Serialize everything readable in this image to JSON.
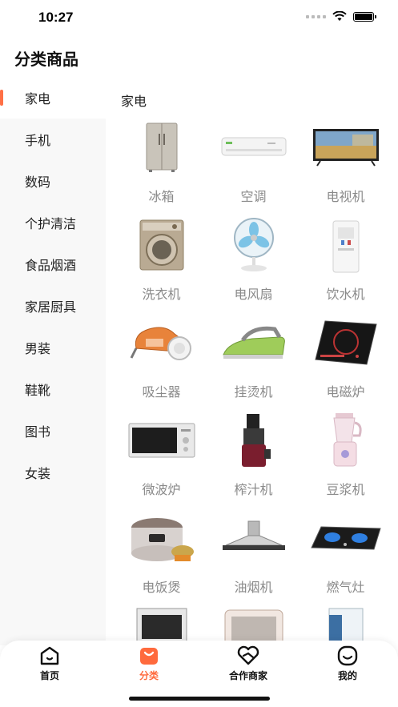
{
  "status": {
    "time": "10:27"
  },
  "page": {
    "title": "分类商品"
  },
  "sidebar": {
    "items": [
      {
        "label": "家电"
      },
      {
        "label": "手机"
      },
      {
        "label": "数码"
      },
      {
        "label": "个护清洁"
      },
      {
        "label": "食品烟酒"
      },
      {
        "label": "家居厨具"
      },
      {
        "label": "男装"
      },
      {
        "label": "鞋靴"
      },
      {
        "label": "图书"
      },
      {
        "label": "女装"
      }
    ]
  },
  "content": {
    "title": "家电",
    "products": [
      {
        "label": "冰箱",
        "icon": "fridge-icon"
      },
      {
        "label": "空调",
        "icon": "air-conditioner-icon"
      },
      {
        "label": "电视机",
        "icon": "tv-icon"
      },
      {
        "label": "洗衣机",
        "icon": "washing-machine-icon"
      },
      {
        "label": "电风扇",
        "icon": "fan-icon"
      },
      {
        "label": "饮水机",
        "icon": "water-dispenser-icon"
      },
      {
        "label": "吸尘器",
        "icon": "vacuum-icon"
      },
      {
        "label": "挂烫机",
        "icon": "iron-icon"
      },
      {
        "label": "电磁炉",
        "icon": "induction-cooker-icon"
      },
      {
        "label": "微波炉",
        "icon": "microwave-icon"
      },
      {
        "label": "榨汁机",
        "icon": "juicer-icon"
      },
      {
        "label": "豆浆机",
        "icon": "blender-icon"
      },
      {
        "label": "电饭煲",
        "icon": "rice-cooker-icon"
      },
      {
        "label": "油烟机",
        "icon": "range-hood-icon"
      },
      {
        "label": "燃气灶",
        "icon": "gas-stove-icon"
      }
    ]
  },
  "tabbar": {
    "items": [
      {
        "label": "首页",
        "icon": "home-icon"
      },
      {
        "label": "分类",
        "icon": "category-bag-icon"
      },
      {
        "label": "合作商家",
        "icon": "heart-handshake-icon"
      },
      {
        "label": "我的",
        "icon": "smile-profile-icon"
      }
    ]
  },
  "colors": {
    "accent": "#ff6a3d",
    "sidebar_bg": "#f8f8f8",
    "label_gray": "#8a8a8a"
  }
}
